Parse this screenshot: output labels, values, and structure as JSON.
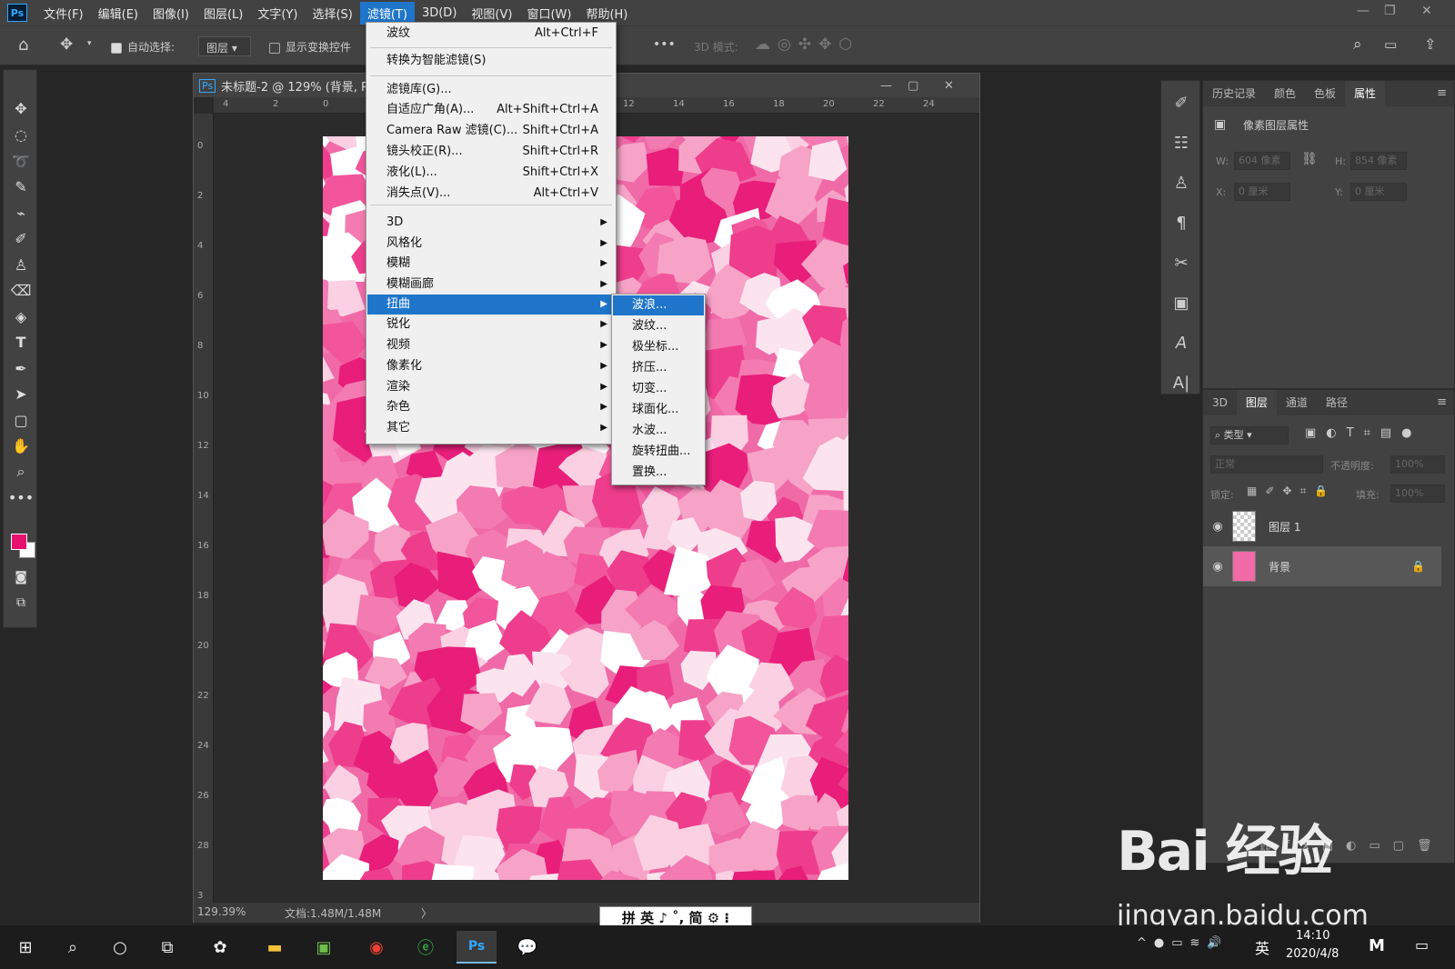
{
  "app": {
    "logo": "Ps"
  },
  "menubar": {
    "items": [
      "文件(F)",
      "编辑(E)",
      "图像(I)",
      "图层(L)",
      "文字(Y)",
      "选择(S)",
      "滤镜(T)",
      "3D(D)",
      "视图(V)",
      "窗口(W)",
      "帮助(H)"
    ],
    "active_index": 6
  },
  "optionsbar": {
    "auto_select_label": "自动选择:",
    "auto_select_target": "图层",
    "show_transform_label": "显示变换控件",
    "mode_3d_label": "3D 模式:",
    "more": "•••"
  },
  "document": {
    "tab_title": "未标题-2 @ 129% (背景, R",
    "ruler_h": [
      "4",
      "2",
      "0",
      "",
      "",
      "",
      "",
      "",
      "12",
      "14",
      "16",
      "18",
      "20",
      "22",
      "24"
    ],
    "ruler_v": [
      "0",
      "2",
      "4",
      "6",
      "8",
      "10",
      "12",
      "14",
      "16",
      "18",
      "20",
      "22",
      "24",
      "26",
      "28",
      "3"
    ],
    "zoom": "129.39%",
    "doc_info": "文档:1.48M/1.48M"
  },
  "filter_menu": {
    "items": [
      {
        "label": "波纹",
        "shortcut": "Alt+Ctrl+F"
      },
      {
        "label": "转换为智能滤镜(S)",
        "shortcut": ""
      },
      {
        "label": "滤镜库(G)...",
        "shortcut": ""
      },
      {
        "label": "自适应广角(A)...",
        "shortcut": "Alt+Shift+Ctrl+A"
      },
      {
        "label": "Camera Raw 滤镜(C)...",
        "shortcut": "Shift+Ctrl+A"
      },
      {
        "label": "镜头校正(R)...",
        "shortcut": "Shift+Ctrl+R"
      },
      {
        "label": "液化(L)...",
        "shortcut": "Shift+Ctrl+X"
      },
      {
        "label": "消失点(V)...",
        "shortcut": "Alt+Ctrl+V"
      },
      {
        "label": "3D",
        "shortcut": ""
      },
      {
        "label": "风格化",
        "shortcut": ""
      },
      {
        "label": "模糊",
        "shortcut": ""
      },
      {
        "label": "模糊画廊",
        "shortcut": ""
      },
      {
        "label": "扭曲",
        "shortcut": ""
      },
      {
        "label": "锐化",
        "shortcut": ""
      },
      {
        "label": "视频",
        "shortcut": ""
      },
      {
        "label": "像素化",
        "shortcut": ""
      },
      {
        "label": "渲染",
        "shortcut": ""
      },
      {
        "label": "杂色",
        "shortcut": ""
      },
      {
        "label": "其它",
        "shortcut": ""
      }
    ],
    "highlighted": "扭曲"
  },
  "distort_submenu": {
    "items": [
      "波浪...",
      "波纹...",
      "极坐标...",
      "挤压...",
      "切变...",
      "球面化...",
      "水波...",
      "旋转扭曲...",
      "置换..."
    ],
    "highlighted": "波浪..."
  },
  "properties_panel": {
    "tabs": [
      "历史记录",
      "颜色",
      "色板",
      "属性"
    ],
    "active_tab": "属性",
    "heading": "像素图层属性",
    "w_label": "W:",
    "w_value": "604 像素",
    "h_label": "H:",
    "h_value": "854 像素",
    "x_label": "X:",
    "x_value": "0 厘米",
    "y_label": "Y:",
    "y_value": "0 厘米"
  },
  "layers_panel": {
    "tabs": [
      "3D",
      "图层",
      "通道",
      "路径"
    ],
    "active_tab": "图层",
    "filter_kind": "类型",
    "blend_mode": "正常",
    "opacity_label": "不透明度:",
    "opacity_value": "100%",
    "lock_label": "锁定:",
    "fill_label": "填充:",
    "fill_value": "100%",
    "layers": [
      {
        "name": "图层 1"
      },
      {
        "name": "背景"
      }
    ]
  },
  "ime": {
    "text": "拼 英 ♪ ˚, 简 ⚙ ⁝"
  },
  "taskbar": {
    "tray_lang": "英",
    "time": "14:10",
    "date": "2020/4/8"
  },
  "watermark": {
    "line1": "Bai 经验",
    "line2": "jingyan.baidu.com"
  },
  "colors": {
    "accent": "#1f75c9",
    "foreground": "#e8116e",
    "background": "#ffffff"
  }
}
